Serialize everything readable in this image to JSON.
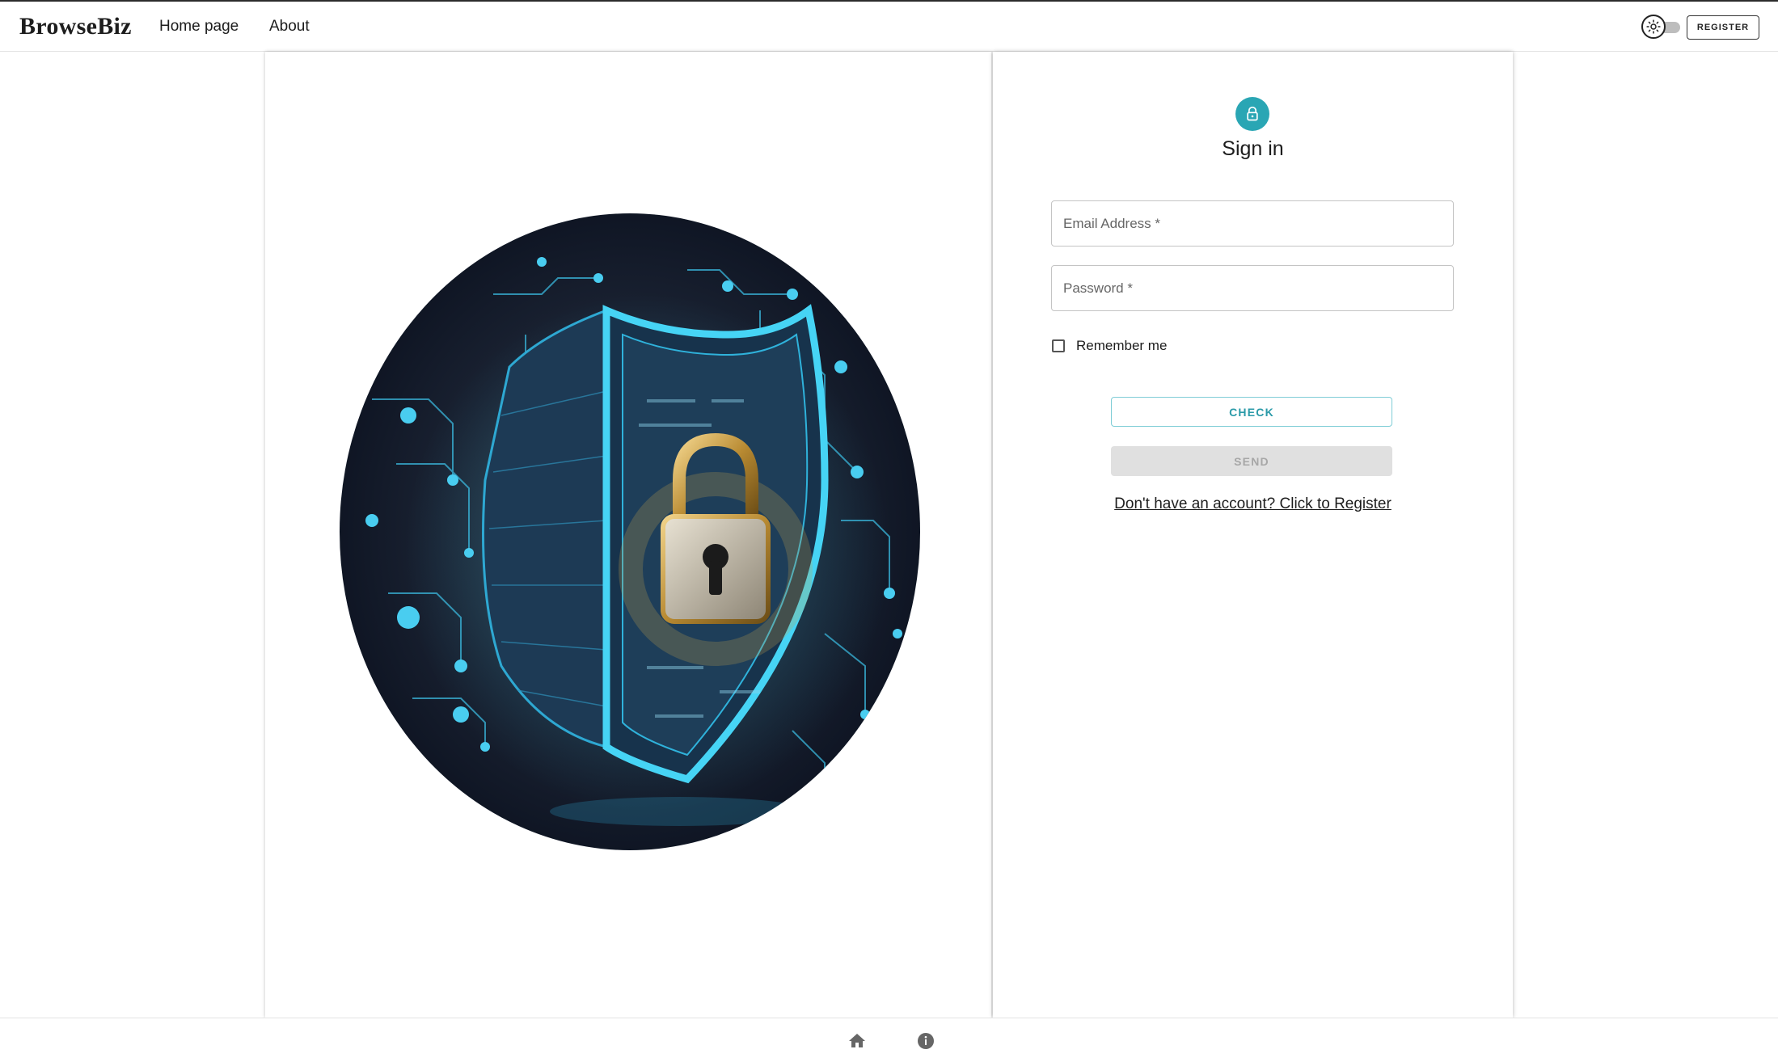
{
  "header": {
    "brand": "BrowseBiz",
    "nav": [
      {
        "label": "Home page"
      },
      {
        "label": "About"
      }
    ],
    "theme_toggle_icon": "sun-icon",
    "register_label": "REGISTER"
  },
  "hero": {
    "illustration": "shield-padlock-illustration",
    "colors": {
      "accent": "#2ec4e6",
      "lock_gold": "#c9a24a",
      "background": "#121a28"
    }
  },
  "signin": {
    "avatar_icon": "lock-icon",
    "avatar_color": "#2aa6b4",
    "title": "Sign in",
    "email": {
      "placeholder": "Email Address *",
      "value": ""
    },
    "password": {
      "placeholder": "Password *",
      "value": ""
    },
    "remember_label": "Remember me",
    "remember_checked": false,
    "check_label": "CHECK",
    "send_label": "SEND",
    "register_link": "Don't have an account? Click to Register"
  },
  "footer": {
    "icons": [
      "home-icon",
      "info-icon"
    ]
  }
}
